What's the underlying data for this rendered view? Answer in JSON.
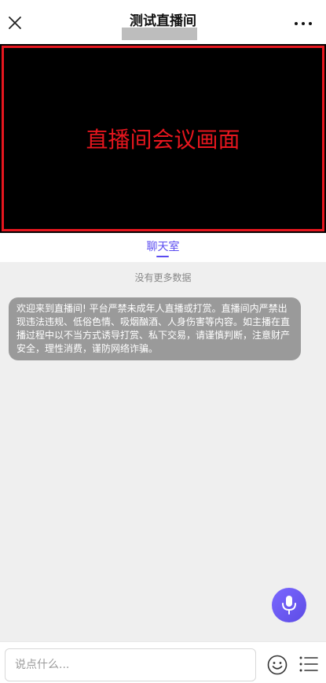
{
  "header": {
    "title": "测试直播间",
    "close_icon": "close-icon",
    "more_icon": "more-dots-icon"
  },
  "video": {
    "overlay_text": "直播间会议画面",
    "frame_color": "#e6161e"
  },
  "tabs": [
    {
      "label": "聊天室",
      "active": true
    }
  ],
  "chat": {
    "no_more_text": "没有更多数据",
    "notice": "欢迎来到直播间! 平台严禁未成年人直播或打赏。直播间内严禁出现违法违规、低俗色情、吸烟酗酒、人身伤害等内容。如主播在直播过程中以不当方式诱导打赏、私下交易，请谨慎判断，注意财产安全，理性消费，谨防网络诈骗。"
  },
  "input": {
    "placeholder": "说点什么..."
  },
  "icons": {
    "mic": "microphone-icon",
    "emoji": "emoji-icon",
    "menu": "menu-list-icon"
  },
  "colors": {
    "accent": "#5b4cf0",
    "notice_bg": "#9a9a9a",
    "video_bg": "#000000"
  }
}
